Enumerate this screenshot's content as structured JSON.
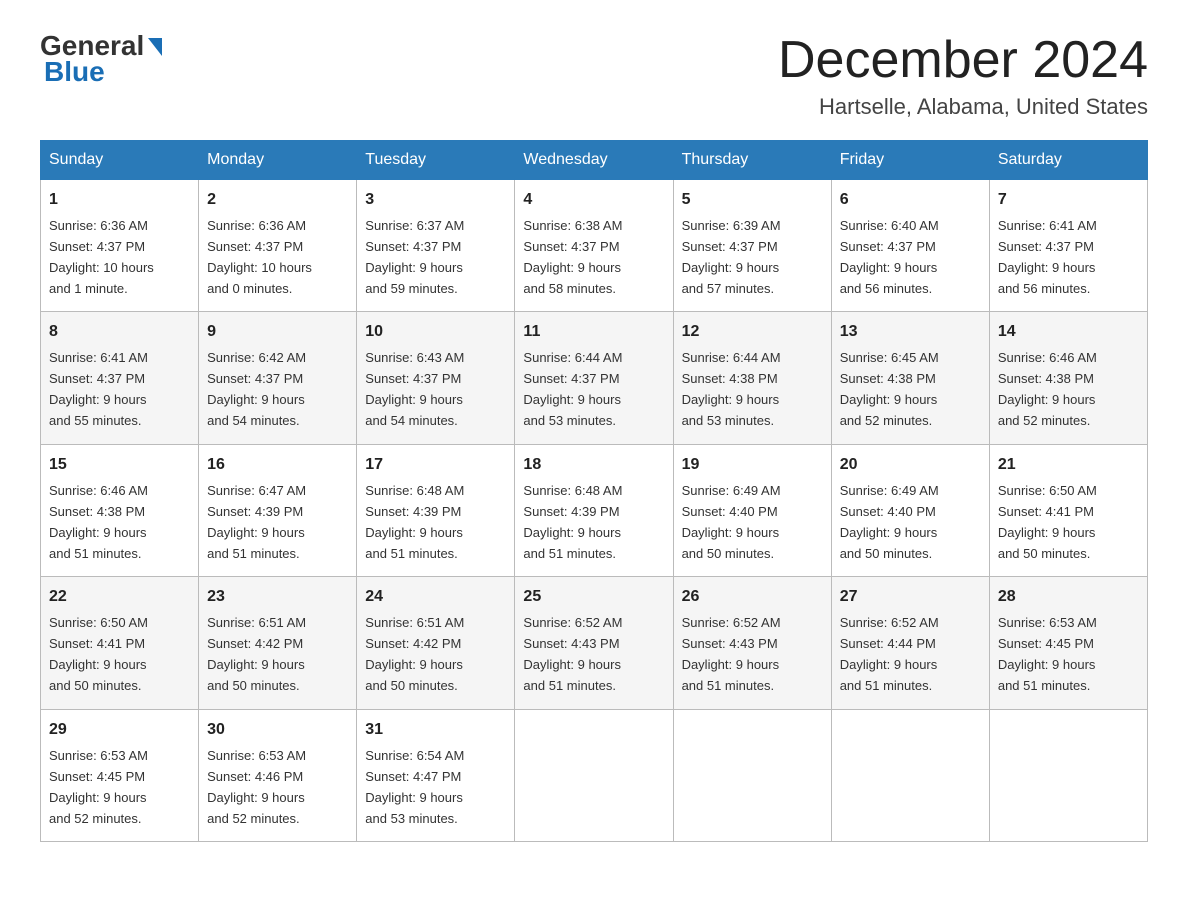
{
  "header": {
    "logo_general": "General",
    "logo_blue": "Blue",
    "month_title": "December 2024",
    "location": "Hartselle, Alabama, United States"
  },
  "weekdays": [
    "Sunday",
    "Monday",
    "Tuesday",
    "Wednesday",
    "Thursday",
    "Friday",
    "Saturday"
  ],
  "weeks": [
    [
      {
        "num": "1",
        "sunrise": "6:36 AM",
        "sunset": "4:37 PM",
        "daylight": "10 hours and 1 minute."
      },
      {
        "num": "2",
        "sunrise": "6:36 AM",
        "sunset": "4:37 PM",
        "daylight": "10 hours and 0 minutes."
      },
      {
        "num": "3",
        "sunrise": "6:37 AM",
        "sunset": "4:37 PM",
        "daylight": "9 hours and 59 minutes."
      },
      {
        "num": "4",
        "sunrise": "6:38 AM",
        "sunset": "4:37 PM",
        "daylight": "9 hours and 58 minutes."
      },
      {
        "num": "5",
        "sunrise": "6:39 AM",
        "sunset": "4:37 PM",
        "daylight": "9 hours and 57 minutes."
      },
      {
        "num": "6",
        "sunrise": "6:40 AM",
        "sunset": "4:37 PM",
        "daylight": "9 hours and 56 minutes."
      },
      {
        "num": "7",
        "sunrise": "6:41 AM",
        "sunset": "4:37 PM",
        "daylight": "9 hours and 56 minutes."
      }
    ],
    [
      {
        "num": "8",
        "sunrise": "6:41 AM",
        "sunset": "4:37 PM",
        "daylight": "9 hours and 55 minutes."
      },
      {
        "num": "9",
        "sunrise": "6:42 AM",
        "sunset": "4:37 PM",
        "daylight": "9 hours and 54 minutes."
      },
      {
        "num": "10",
        "sunrise": "6:43 AM",
        "sunset": "4:37 PM",
        "daylight": "9 hours and 54 minutes."
      },
      {
        "num": "11",
        "sunrise": "6:44 AM",
        "sunset": "4:37 PM",
        "daylight": "9 hours and 53 minutes."
      },
      {
        "num": "12",
        "sunrise": "6:44 AM",
        "sunset": "4:38 PM",
        "daylight": "9 hours and 53 minutes."
      },
      {
        "num": "13",
        "sunrise": "6:45 AM",
        "sunset": "4:38 PM",
        "daylight": "9 hours and 52 minutes."
      },
      {
        "num": "14",
        "sunrise": "6:46 AM",
        "sunset": "4:38 PM",
        "daylight": "9 hours and 52 minutes."
      }
    ],
    [
      {
        "num": "15",
        "sunrise": "6:46 AM",
        "sunset": "4:38 PM",
        "daylight": "9 hours and 51 minutes."
      },
      {
        "num": "16",
        "sunrise": "6:47 AM",
        "sunset": "4:39 PM",
        "daylight": "9 hours and 51 minutes."
      },
      {
        "num": "17",
        "sunrise": "6:48 AM",
        "sunset": "4:39 PM",
        "daylight": "9 hours and 51 minutes."
      },
      {
        "num": "18",
        "sunrise": "6:48 AM",
        "sunset": "4:39 PM",
        "daylight": "9 hours and 51 minutes."
      },
      {
        "num": "19",
        "sunrise": "6:49 AM",
        "sunset": "4:40 PM",
        "daylight": "9 hours and 50 minutes."
      },
      {
        "num": "20",
        "sunrise": "6:49 AM",
        "sunset": "4:40 PM",
        "daylight": "9 hours and 50 minutes."
      },
      {
        "num": "21",
        "sunrise": "6:50 AM",
        "sunset": "4:41 PM",
        "daylight": "9 hours and 50 minutes."
      }
    ],
    [
      {
        "num": "22",
        "sunrise": "6:50 AM",
        "sunset": "4:41 PM",
        "daylight": "9 hours and 50 minutes."
      },
      {
        "num": "23",
        "sunrise": "6:51 AM",
        "sunset": "4:42 PM",
        "daylight": "9 hours and 50 minutes."
      },
      {
        "num": "24",
        "sunrise": "6:51 AM",
        "sunset": "4:42 PM",
        "daylight": "9 hours and 50 minutes."
      },
      {
        "num": "25",
        "sunrise": "6:52 AM",
        "sunset": "4:43 PM",
        "daylight": "9 hours and 51 minutes."
      },
      {
        "num": "26",
        "sunrise": "6:52 AM",
        "sunset": "4:43 PM",
        "daylight": "9 hours and 51 minutes."
      },
      {
        "num": "27",
        "sunrise": "6:52 AM",
        "sunset": "4:44 PM",
        "daylight": "9 hours and 51 minutes."
      },
      {
        "num": "28",
        "sunrise": "6:53 AM",
        "sunset": "4:45 PM",
        "daylight": "9 hours and 51 minutes."
      }
    ],
    [
      {
        "num": "29",
        "sunrise": "6:53 AM",
        "sunset": "4:45 PM",
        "daylight": "9 hours and 52 minutes."
      },
      {
        "num": "30",
        "sunrise": "6:53 AM",
        "sunset": "4:46 PM",
        "daylight": "9 hours and 52 minutes."
      },
      {
        "num": "31",
        "sunrise": "6:54 AM",
        "sunset": "4:47 PM",
        "daylight": "9 hours and 53 minutes."
      },
      {
        "num": "",
        "sunrise": "",
        "sunset": "",
        "daylight": ""
      },
      {
        "num": "",
        "sunrise": "",
        "sunset": "",
        "daylight": ""
      },
      {
        "num": "",
        "sunrise": "",
        "sunset": "",
        "daylight": ""
      },
      {
        "num": "",
        "sunrise": "",
        "sunset": "",
        "daylight": ""
      }
    ]
  ],
  "labels": {
    "sunrise": "Sunrise:",
    "sunset": "Sunset:",
    "daylight": "Daylight:"
  }
}
